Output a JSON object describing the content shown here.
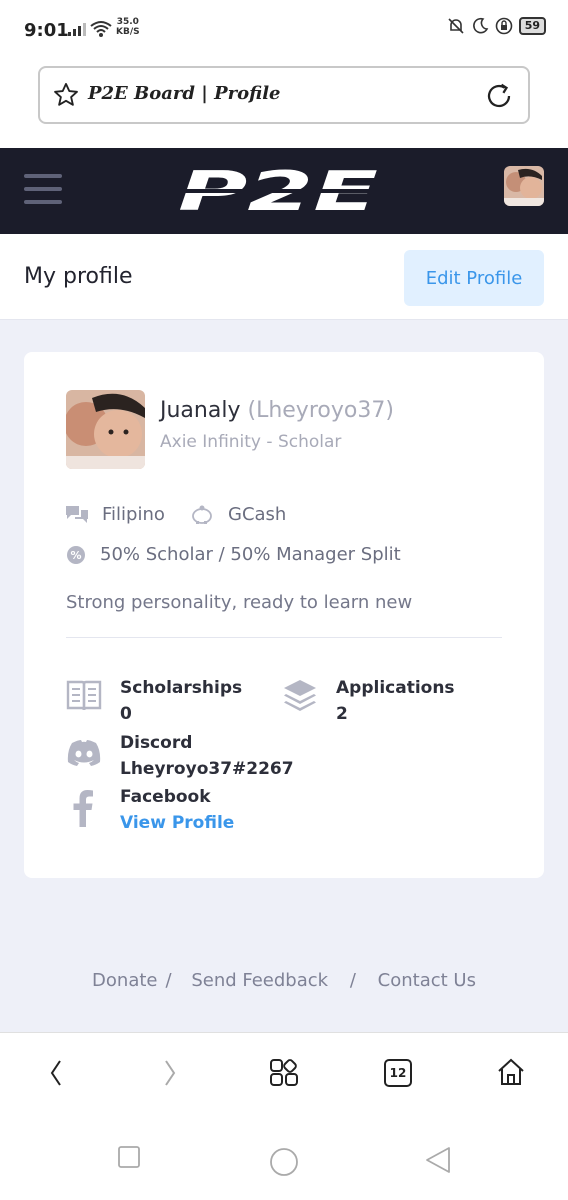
{
  "status_bar": {
    "time": "9:01",
    "net_speed_value": "35.0",
    "net_speed_unit": "KB/S",
    "battery": "59"
  },
  "browser": {
    "tab_title": "P2E Board | Profile"
  },
  "header": {
    "logo_text": "P2E"
  },
  "page": {
    "title": "My profile",
    "edit_label": "Edit Profile"
  },
  "profile": {
    "name": "Juanaly",
    "handle": "(Lheyroyo37)",
    "subtitle": "Axie Infinity - Scholar",
    "language": "Filipino",
    "payment": "GCash",
    "split": "50% Scholar / 50% Manager Split",
    "bio": "Strong personality, ready to learn new"
  },
  "stats": {
    "scholarships_label": "Scholarships",
    "scholarships_value": "0",
    "applications_label": "Applications",
    "applications_value": "2",
    "discord_label": "Discord",
    "discord_value": "Lheyroyo37#2267",
    "facebook_label": "Facebook",
    "facebook_link": "View Profile"
  },
  "footer": {
    "donate": "Donate",
    "feedback": "Send Feedback",
    "contact": "Contact Us",
    "separator": "/"
  },
  "browser_nav": {
    "tab_count": "12"
  }
}
